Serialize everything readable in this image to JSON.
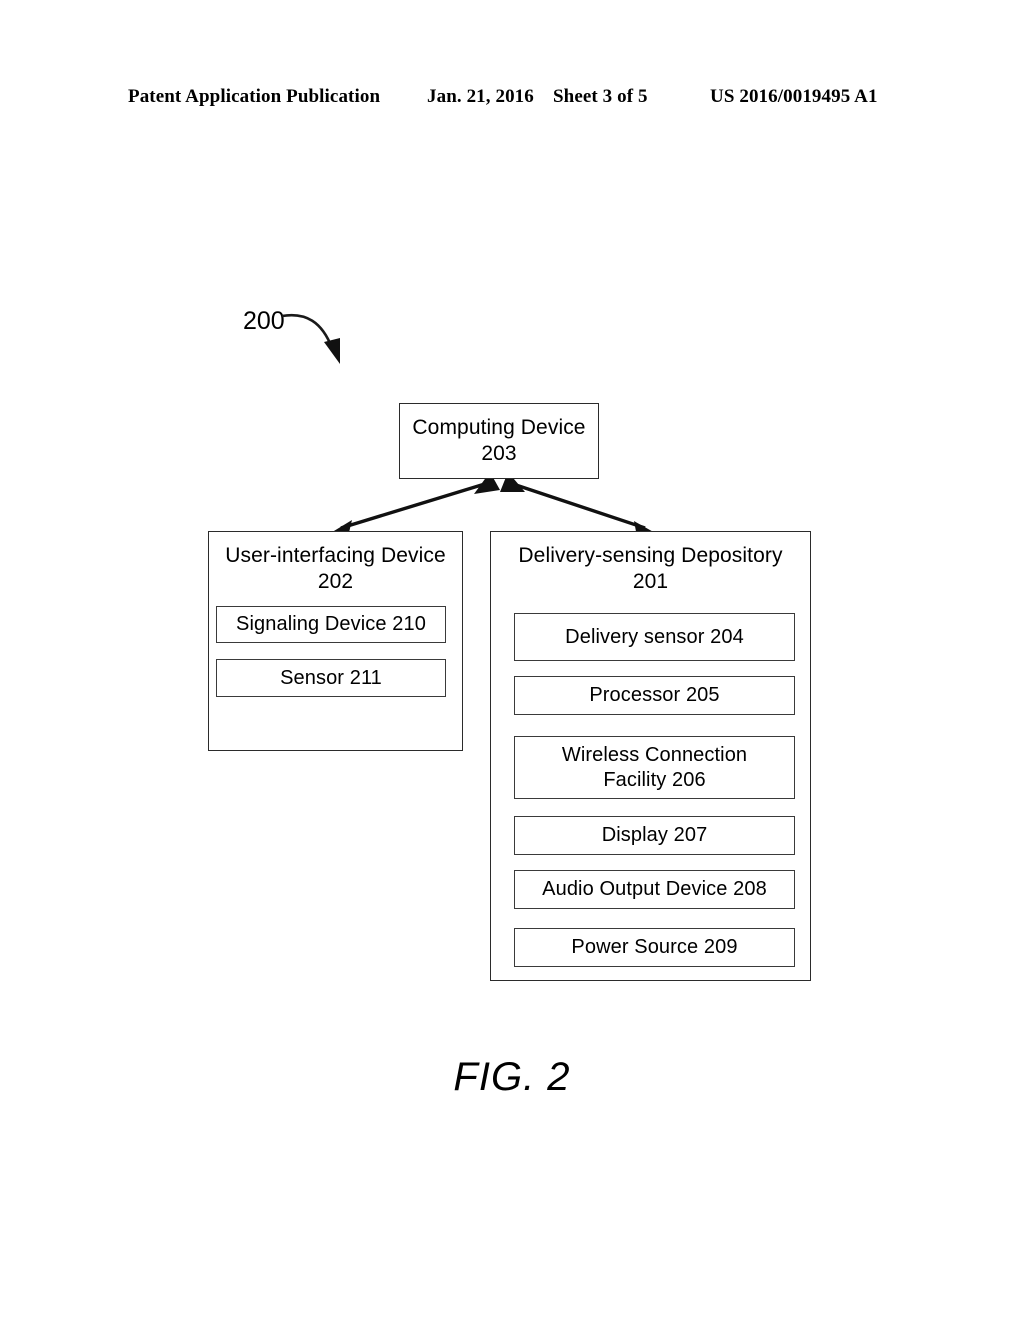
{
  "header": {
    "publication": "Patent Application Publication",
    "date": "Jan. 21, 2016",
    "sheet": "Sheet 3 of 5",
    "document_number": "US 2016/0019495 A1"
  },
  "figure": {
    "caption": "FIG. 2",
    "system_reference": "200",
    "boxes": {
      "computing_device": {
        "label": "Computing Device\n203",
        "reference": "203"
      },
      "user_interfacing_device": {
        "label": "User-interfacing Device\n202",
        "reference": "202",
        "children": [
          {
            "label": "Signaling Device 210",
            "reference": "210"
          },
          {
            "label": "Sensor 211",
            "reference": "211"
          }
        ]
      },
      "delivery_sensing_depository": {
        "label": "Delivery-sensing Depository\n201",
        "reference": "201",
        "children": [
          {
            "label": "Delivery sensor 204",
            "reference": "204"
          },
          {
            "label": "Processor 205",
            "reference": "205"
          },
          {
            "label": "Wireless Connection\nFacility 206",
            "reference": "206"
          },
          {
            "label": "Display 207",
            "reference": "207"
          },
          {
            "label": "Audio Output Device 208",
            "reference": "208"
          },
          {
            "label": "Power Source 209",
            "reference": "209"
          }
        ]
      }
    },
    "connections": [
      {
        "from": "computing_device",
        "to": "user_interfacing_device",
        "style": "double-headed-arrow"
      },
      {
        "from": "computing_device",
        "to": "delivery_sensing_depository",
        "style": "double-headed-arrow"
      }
    ],
    "colors": {
      "line": "#2b2b2b",
      "background": "#ffffff",
      "text": "#000000"
    }
  }
}
